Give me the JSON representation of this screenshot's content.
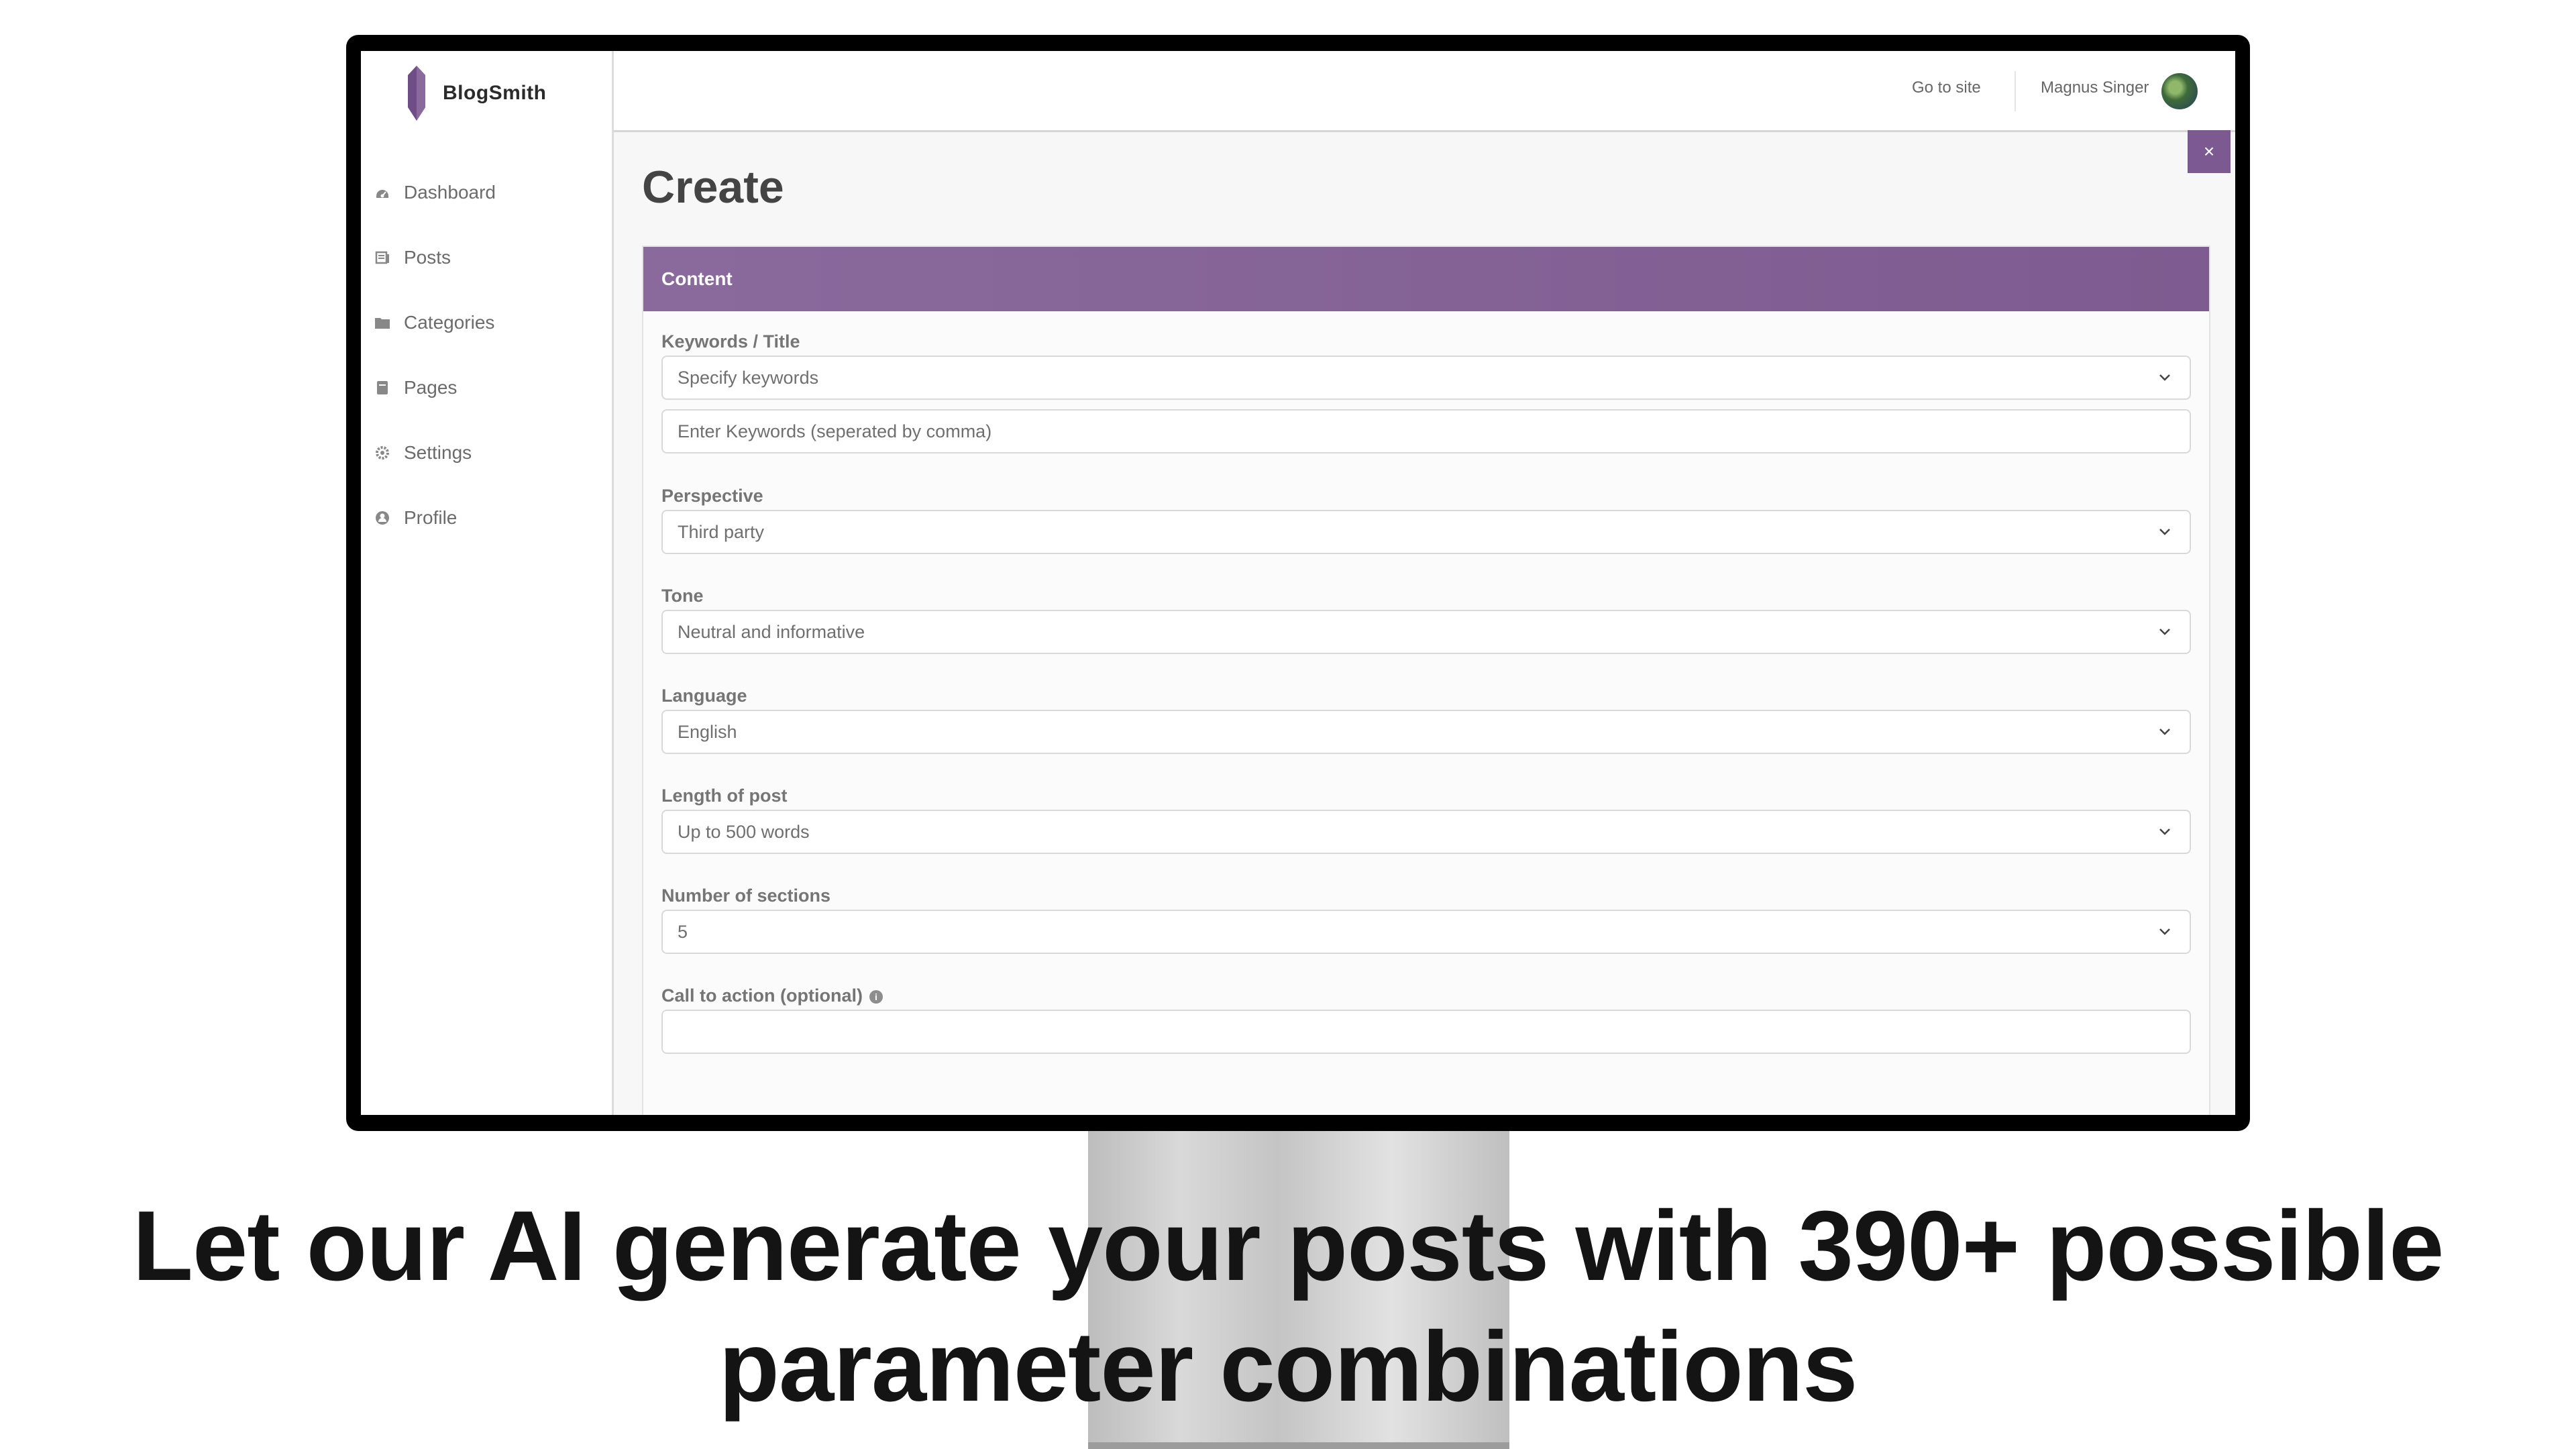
{
  "app": {
    "name": "BlogSmith",
    "accent_color": "#7c5a91"
  },
  "sidebar": {
    "items": [
      {
        "label": "Dashboard",
        "icon": "dashboard-icon"
      },
      {
        "label": "Posts",
        "icon": "posts-icon"
      },
      {
        "label": "Categories",
        "icon": "folder-icon"
      },
      {
        "label": "Pages",
        "icon": "page-icon"
      },
      {
        "label": "Settings",
        "icon": "gear-icon"
      },
      {
        "label": "Profile",
        "icon": "user-icon"
      }
    ]
  },
  "header": {
    "go_to_site": "Go to site",
    "user_name": "Magnus Singer",
    "close_label": "×"
  },
  "main": {
    "title": "Create",
    "card_title": "Content",
    "fields": {
      "keywords": {
        "label": "Keywords / Title",
        "value": "Specify keywords",
        "input_placeholder": "Enter Keywords (seperated by comma)"
      },
      "perspective": {
        "label": "Perspective",
        "value": "Third party"
      },
      "tone": {
        "label": "Tone",
        "value": "Neutral and informative"
      },
      "language": {
        "label": "Language",
        "value": "English"
      },
      "length": {
        "label": "Length of post",
        "value": "Up to 500 words"
      },
      "sections": {
        "label": "Number of sections",
        "value": "5"
      },
      "cta": {
        "label": "Call to action (optional)",
        "info": "i",
        "value": ""
      }
    }
  },
  "headline": {
    "line1": "Let our AI generate your posts with 390+ possible",
    "line2": "parameter combinations"
  }
}
